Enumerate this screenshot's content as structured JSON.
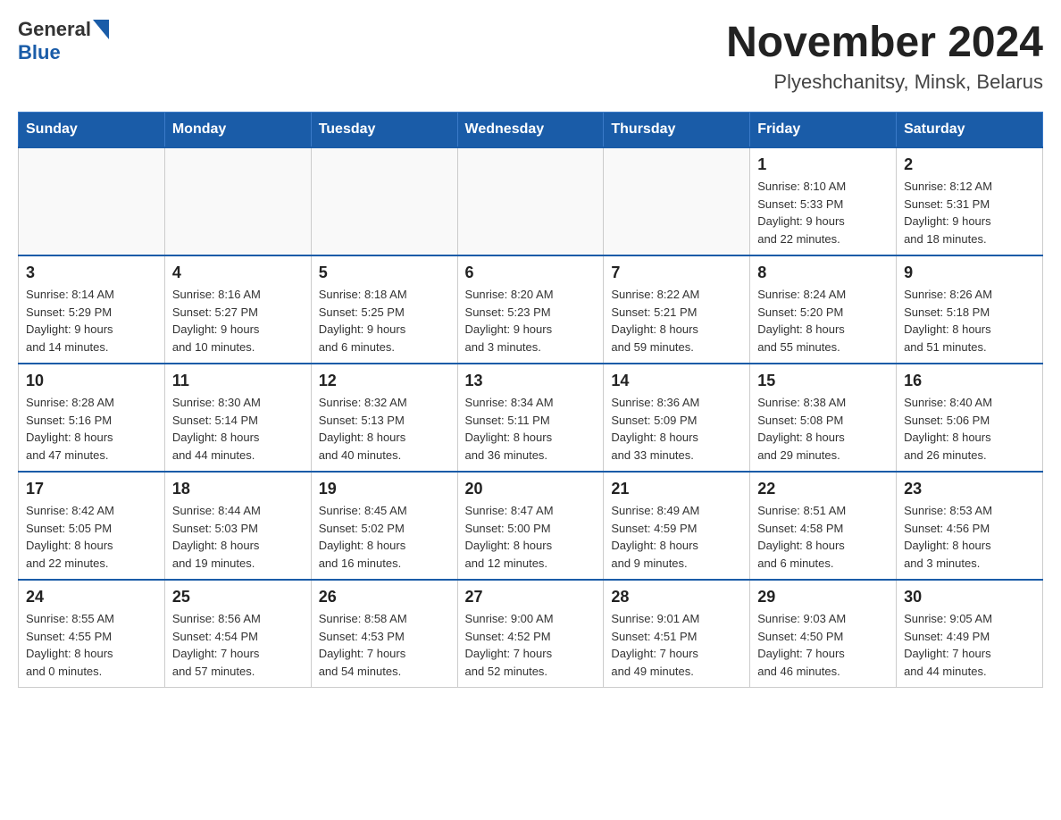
{
  "header": {
    "logo_general": "General",
    "logo_blue": "Blue",
    "month_title": "November 2024",
    "location": "Plyeshchanitsy, Minsk, Belarus"
  },
  "days_of_week": [
    "Sunday",
    "Monday",
    "Tuesday",
    "Wednesday",
    "Thursday",
    "Friday",
    "Saturday"
  ],
  "weeks": [
    [
      {
        "day": "",
        "info": ""
      },
      {
        "day": "",
        "info": ""
      },
      {
        "day": "",
        "info": ""
      },
      {
        "day": "",
        "info": ""
      },
      {
        "day": "",
        "info": ""
      },
      {
        "day": "1",
        "info": "Sunrise: 8:10 AM\nSunset: 5:33 PM\nDaylight: 9 hours\nand 22 minutes."
      },
      {
        "day": "2",
        "info": "Sunrise: 8:12 AM\nSunset: 5:31 PM\nDaylight: 9 hours\nand 18 minutes."
      }
    ],
    [
      {
        "day": "3",
        "info": "Sunrise: 8:14 AM\nSunset: 5:29 PM\nDaylight: 9 hours\nand 14 minutes."
      },
      {
        "day": "4",
        "info": "Sunrise: 8:16 AM\nSunset: 5:27 PM\nDaylight: 9 hours\nand 10 minutes."
      },
      {
        "day": "5",
        "info": "Sunrise: 8:18 AM\nSunset: 5:25 PM\nDaylight: 9 hours\nand 6 minutes."
      },
      {
        "day": "6",
        "info": "Sunrise: 8:20 AM\nSunset: 5:23 PM\nDaylight: 9 hours\nand 3 minutes."
      },
      {
        "day": "7",
        "info": "Sunrise: 8:22 AM\nSunset: 5:21 PM\nDaylight: 8 hours\nand 59 minutes."
      },
      {
        "day": "8",
        "info": "Sunrise: 8:24 AM\nSunset: 5:20 PM\nDaylight: 8 hours\nand 55 minutes."
      },
      {
        "day": "9",
        "info": "Sunrise: 8:26 AM\nSunset: 5:18 PM\nDaylight: 8 hours\nand 51 minutes."
      }
    ],
    [
      {
        "day": "10",
        "info": "Sunrise: 8:28 AM\nSunset: 5:16 PM\nDaylight: 8 hours\nand 47 minutes."
      },
      {
        "day": "11",
        "info": "Sunrise: 8:30 AM\nSunset: 5:14 PM\nDaylight: 8 hours\nand 44 minutes."
      },
      {
        "day": "12",
        "info": "Sunrise: 8:32 AM\nSunset: 5:13 PM\nDaylight: 8 hours\nand 40 minutes."
      },
      {
        "day": "13",
        "info": "Sunrise: 8:34 AM\nSunset: 5:11 PM\nDaylight: 8 hours\nand 36 minutes."
      },
      {
        "day": "14",
        "info": "Sunrise: 8:36 AM\nSunset: 5:09 PM\nDaylight: 8 hours\nand 33 minutes."
      },
      {
        "day": "15",
        "info": "Sunrise: 8:38 AM\nSunset: 5:08 PM\nDaylight: 8 hours\nand 29 minutes."
      },
      {
        "day": "16",
        "info": "Sunrise: 8:40 AM\nSunset: 5:06 PM\nDaylight: 8 hours\nand 26 minutes."
      }
    ],
    [
      {
        "day": "17",
        "info": "Sunrise: 8:42 AM\nSunset: 5:05 PM\nDaylight: 8 hours\nand 22 minutes."
      },
      {
        "day": "18",
        "info": "Sunrise: 8:44 AM\nSunset: 5:03 PM\nDaylight: 8 hours\nand 19 minutes."
      },
      {
        "day": "19",
        "info": "Sunrise: 8:45 AM\nSunset: 5:02 PM\nDaylight: 8 hours\nand 16 minutes."
      },
      {
        "day": "20",
        "info": "Sunrise: 8:47 AM\nSunset: 5:00 PM\nDaylight: 8 hours\nand 12 minutes."
      },
      {
        "day": "21",
        "info": "Sunrise: 8:49 AM\nSunset: 4:59 PM\nDaylight: 8 hours\nand 9 minutes."
      },
      {
        "day": "22",
        "info": "Sunrise: 8:51 AM\nSunset: 4:58 PM\nDaylight: 8 hours\nand 6 minutes."
      },
      {
        "day": "23",
        "info": "Sunrise: 8:53 AM\nSunset: 4:56 PM\nDaylight: 8 hours\nand 3 minutes."
      }
    ],
    [
      {
        "day": "24",
        "info": "Sunrise: 8:55 AM\nSunset: 4:55 PM\nDaylight: 8 hours\nand 0 minutes."
      },
      {
        "day": "25",
        "info": "Sunrise: 8:56 AM\nSunset: 4:54 PM\nDaylight: 7 hours\nand 57 minutes."
      },
      {
        "day": "26",
        "info": "Sunrise: 8:58 AM\nSunset: 4:53 PM\nDaylight: 7 hours\nand 54 minutes."
      },
      {
        "day": "27",
        "info": "Sunrise: 9:00 AM\nSunset: 4:52 PM\nDaylight: 7 hours\nand 52 minutes."
      },
      {
        "day": "28",
        "info": "Sunrise: 9:01 AM\nSunset: 4:51 PM\nDaylight: 7 hours\nand 49 minutes."
      },
      {
        "day": "29",
        "info": "Sunrise: 9:03 AM\nSunset: 4:50 PM\nDaylight: 7 hours\nand 46 minutes."
      },
      {
        "day": "30",
        "info": "Sunrise: 9:05 AM\nSunset: 4:49 PM\nDaylight: 7 hours\nand 44 minutes."
      }
    ]
  ]
}
